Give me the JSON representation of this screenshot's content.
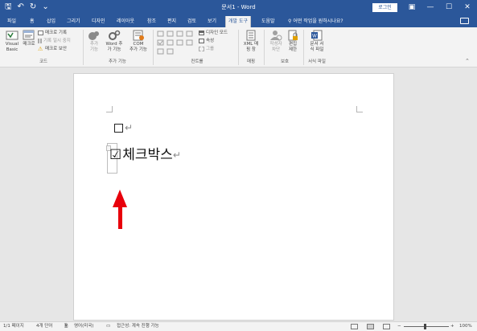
{
  "titlebar": {
    "title": "문서1 - Word",
    "login": "로그인",
    "qat": {
      "save_icon": "🖫",
      "undo_icon": "↶",
      "redo_icon": "↻",
      "customize_icon": "⌄"
    },
    "controls": {
      "ribbon_display": "▣",
      "minimize": "—",
      "maximize": "☐",
      "close": "✕"
    }
  },
  "tabs": [
    "파일",
    "홈",
    "삽입",
    "그리기",
    "디자인",
    "레이아웃",
    "참조",
    "편지",
    "검토",
    "보기",
    "개발 도구",
    "도움말"
  ],
  "active_tab": "개발 도구",
  "search": "어떤 작업을 원하시나요?",
  "ribbon": {
    "code": {
      "group": "코드",
      "visual_basic": [
        "Visual",
        "Basic"
      ],
      "macros": "매크로",
      "record_macro": "매크로 기록",
      "pause_recording": "기록 일시 중지",
      "macro_security": "매크로 보안"
    },
    "addins": {
      "group": "추가 기능",
      "addins": [
        "추가",
        "기능"
      ],
      "word_addins": [
        "Word 추",
        "가 기능"
      ],
      "com_addins": [
        "COM",
        "추가 기능"
      ]
    },
    "controls": {
      "group": "컨트롤",
      "design_mode": "디자인 모드",
      "properties": "속성",
      "group_btn": "그룹"
    },
    "mapping": {
      "group": "매핑",
      "xml_pane": [
        "XML 매",
        "핑 창"
      ]
    },
    "protect": {
      "group": "보호",
      "block_authors": [
        "작성자",
        "차단"
      ],
      "restrict_editing": [
        "편집",
        "제한"
      ]
    },
    "templates": {
      "group": "서식 파일",
      "document_template": [
        "문서 서",
        "식 파일"
      ]
    }
  },
  "document": {
    "line1_mark": "↵",
    "line2_box": "☑",
    "line2_text": "체크박스",
    "line2_mark": "↵"
  },
  "status": {
    "page": "1/1 페이지",
    "words": "4개 단어",
    "language": "영어(미국)",
    "accessibility": "접근성: 계속 진행 가능",
    "zoom": "100%",
    "zoom_minus": "−",
    "zoom_plus": "+"
  },
  "colors": {
    "accent": "#2b579a",
    "arrow": "#e8000b"
  }
}
